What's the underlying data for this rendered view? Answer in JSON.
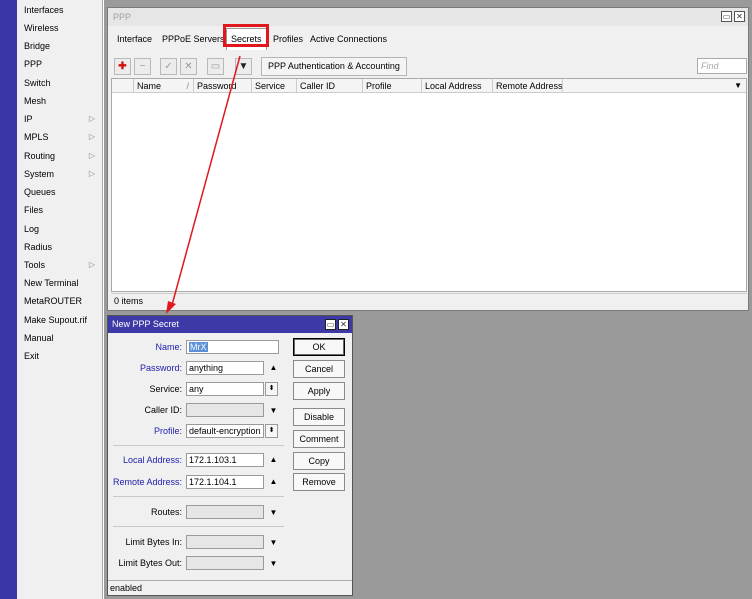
{
  "sidebar": {
    "items": [
      {
        "label": "Interfaces"
      },
      {
        "label": "Wireless"
      },
      {
        "label": "Bridge"
      },
      {
        "label": "PPP"
      },
      {
        "label": "Switch"
      },
      {
        "label": "Mesh"
      },
      {
        "label": "IP",
        "submenu": true
      },
      {
        "label": "MPLS",
        "submenu": true
      },
      {
        "label": "Routing",
        "submenu": true
      },
      {
        "label": "System",
        "submenu": true
      },
      {
        "label": "Queues"
      },
      {
        "label": "Files"
      },
      {
        "label": "Log"
      },
      {
        "label": "Radius"
      },
      {
        "label": "Tools",
        "submenu": true
      },
      {
        "label": "New Terminal"
      },
      {
        "label": "MetaROUTER"
      },
      {
        "label": "Make Supout.rif"
      },
      {
        "label": "Manual"
      },
      {
        "label": "Exit"
      }
    ],
    "arrow_glyph": "▷"
  },
  "ppp_window": {
    "title": "PPP",
    "tabs": [
      "Interface",
      "PPPoE Servers",
      "Secrets",
      "Profiles",
      "Active Connections"
    ],
    "active_tab": "Secrets",
    "toolbar": {
      "add_glyph": "✚",
      "remove_glyph": "−",
      "enable_glyph": "✓",
      "disable_glyph": "✕",
      "comment_glyph": "▭",
      "filter_glyph": "▼",
      "auth_button": "PPP Authentication & Accounting",
      "find_placeholder": "Find"
    },
    "columns": [
      "Name",
      "Password",
      "Service",
      "Caller ID",
      "Profile",
      "Local Address",
      "Remote Address"
    ],
    "sort_glyph": "/",
    "column_menu_glyph": "▼",
    "status": "0 items"
  },
  "dialog": {
    "title": "New PPP Secret",
    "fields": {
      "name_label": "Name:",
      "name_value": "MrX",
      "password_label": "Password:",
      "password_value": "anything",
      "service_label": "Service:",
      "service_value": "any",
      "caller_id_label": "Caller ID:",
      "profile_label": "Profile:",
      "profile_value": "default-encryption",
      "local_label": "Local Address:",
      "local_value": "172.1.103.1",
      "remote_label": "Remote Address:",
      "remote_value": "172.1.104.1",
      "routes_label": "Routes:",
      "limit_in_label": "Limit Bytes In:",
      "limit_out_label": "Limit Bytes Out:"
    },
    "buttons": [
      "OK",
      "Cancel",
      "Apply",
      "Disable",
      "Comment",
      "Copy",
      "Remove"
    ],
    "status": "enabled"
  },
  "window_controls": {
    "restore": "▭",
    "close": "✕"
  },
  "glyphs": {
    "down": "▼",
    "up": "▲",
    "spin": "⬍"
  },
  "colors": {
    "dialog_title": "#3d3aa8",
    "blue_label": "#2020b0",
    "highlight_box": "#e0181e",
    "left_strip": "#3a36a8"
  }
}
